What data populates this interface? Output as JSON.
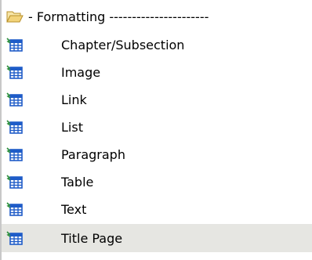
{
  "tree": {
    "group": {
      "label": "- Formatting ----------------------",
      "icon": "folder-open-icon"
    },
    "items": [
      {
        "label": "Chapter/Subsection",
        "icon": "table-icon"
      },
      {
        "label": "Image",
        "icon": "table-icon"
      },
      {
        "label": "Link",
        "icon": "table-icon"
      },
      {
        "label": "List",
        "icon": "table-icon"
      },
      {
        "label": "Paragraph",
        "icon": "table-icon"
      },
      {
        "label": "Table",
        "icon": "table-icon"
      },
      {
        "label": "Text",
        "icon": "table-icon"
      },
      {
        "label": "Title Page",
        "icon": "table-icon",
        "selected": true
      }
    ]
  },
  "colors": {
    "folder": "#f2d37a",
    "table_icon": "#1f5cc8",
    "selection": "#e6e6e2"
  }
}
